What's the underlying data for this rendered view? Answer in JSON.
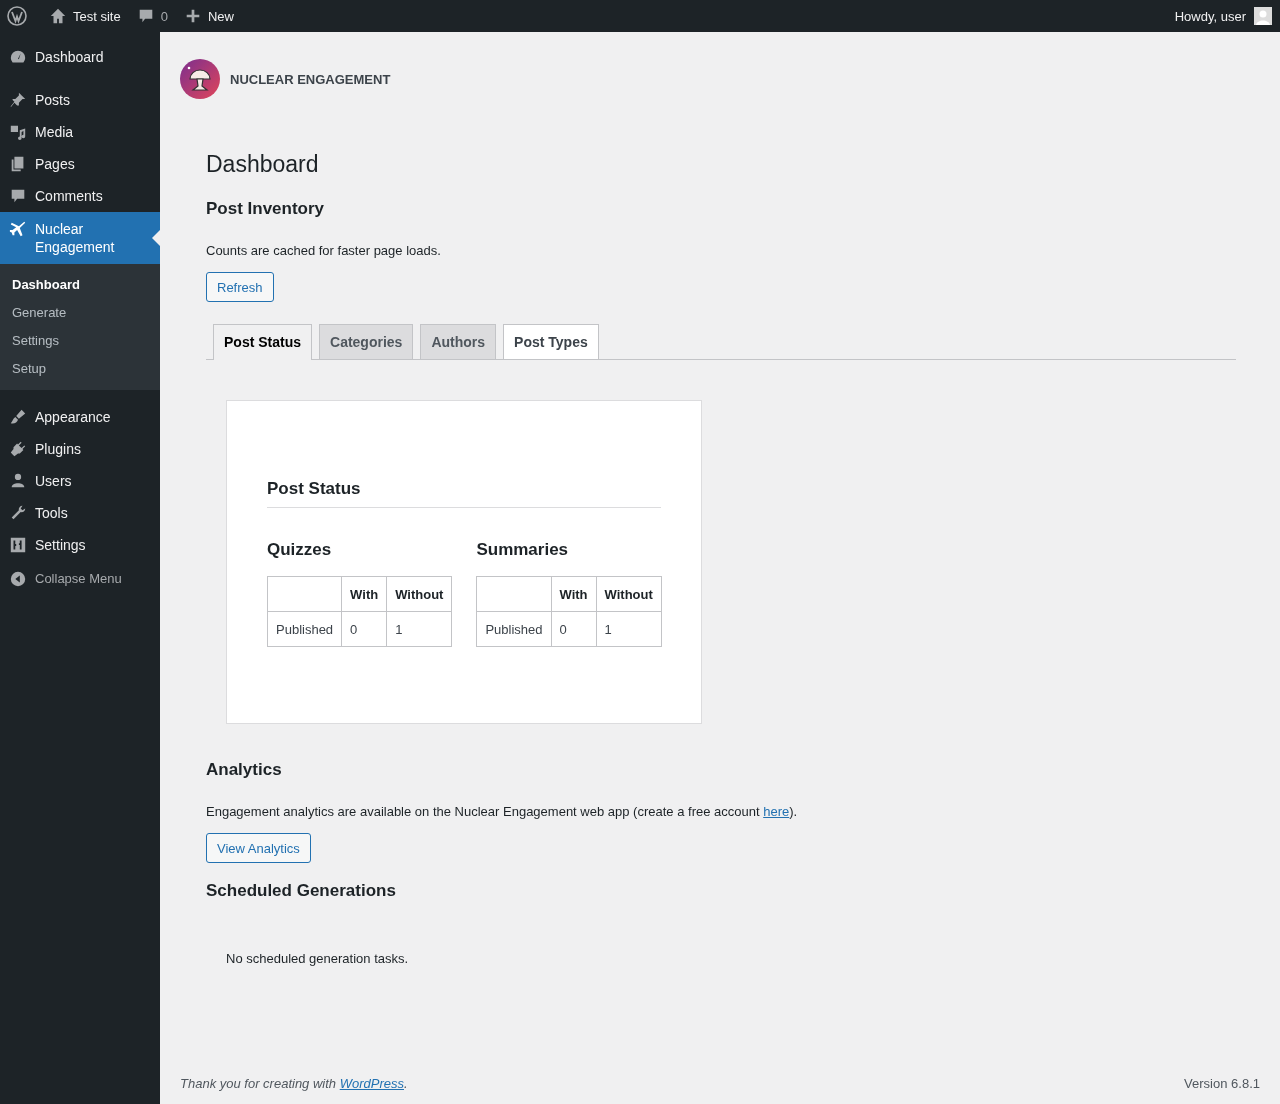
{
  "admin_bar": {
    "site": "Test site",
    "comments": "0",
    "new": "New",
    "greeting": "Howdy, user"
  },
  "sidebar": {
    "items": [
      {
        "label": "Dashboard",
        "selected": false
      },
      {
        "label": "Posts",
        "selected": false
      },
      {
        "label": "Media",
        "selected": false
      },
      {
        "label": "Pages",
        "selected": false
      },
      {
        "label": "Comments",
        "selected": false
      },
      {
        "label": "Nuclear Engagement",
        "selected": true,
        "children": [
          {
            "label": "Dashboard",
            "selected": true
          },
          {
            "label": "Generate",
            "selected": false
          },
          {
            "label": "Settings",
            "selected": false
          },
          {
            "label": "Setup",
            "selected": false
          }
        ]
      },
      {
        "label": "Appearance",
        "selected": false
      },
      {
        "label": "Plugins",
        "selected": false
      },
      {
        "label": "Users",
        "selected": false
      },
      {
        "label": "Tools",
        "selected": false
      },
      {
        "label": "Settings",
        "selected": false
      }
    ],
    "collapse": "Collapse Menu"
  },
  "plugin_header": {
    "name": "NUCLEAR ENGAGEMENT"
  },
  "page_title": "Dashboard",
  "inventory": {
    "heading": "Post Inventory",
    "note": "Counts are cached for faster page loads.",
    "button": "Refresh",
    "tabs": [
      {
        "label": "Post Status",
        "selected": true,
        "hovered": false
      },
      {
        "label": "Categories",
        "selected": false,
        "hovered": false
      },
      {
        "label": "Authors",
        "selected": false,
        "hovered": false
      },
      {
        "label": "Post Types",
        "selected": false,
        "hovered": true
      }
    ],
    "panel": {
      "title": "Post Status",
      "tables": [
        {
          "title": "Quizzes",
          "columns": [
            "With",
            "Without"
          ],
          "rows": [
            {
              "label": "Published",
              "cells": [
                "0",
                "1"
              ]
            }
          ]
        },
        {
          "title": "Summaries",
          "columns": [
            "With",
            "Without"
          ],
          "rows": [
            {
              "label": "Published",
              "cells": [
                "0",
                "1"
              ]
            }
          ]
        }
      ]
    }
  },
  "analytics": {
    "heading": "Analytics",
    "text_before": "Engagement analytics are available on the Nuclear Engagement web app (create a free account ",
    "link": "here",
    "text_after": ").",
    "button": "View Analytics"
  },
  "scheduled": {
    "heading": "Scheduled Generations",
    "empty": "No scheduled generation tasks."
  },
  "footer": {
    "thanks_before": "Thank you for creating with ",
    "link": "WordPress",
    "thanks_after": ".",
    "version": "Version 6.8.1"
  }
}
